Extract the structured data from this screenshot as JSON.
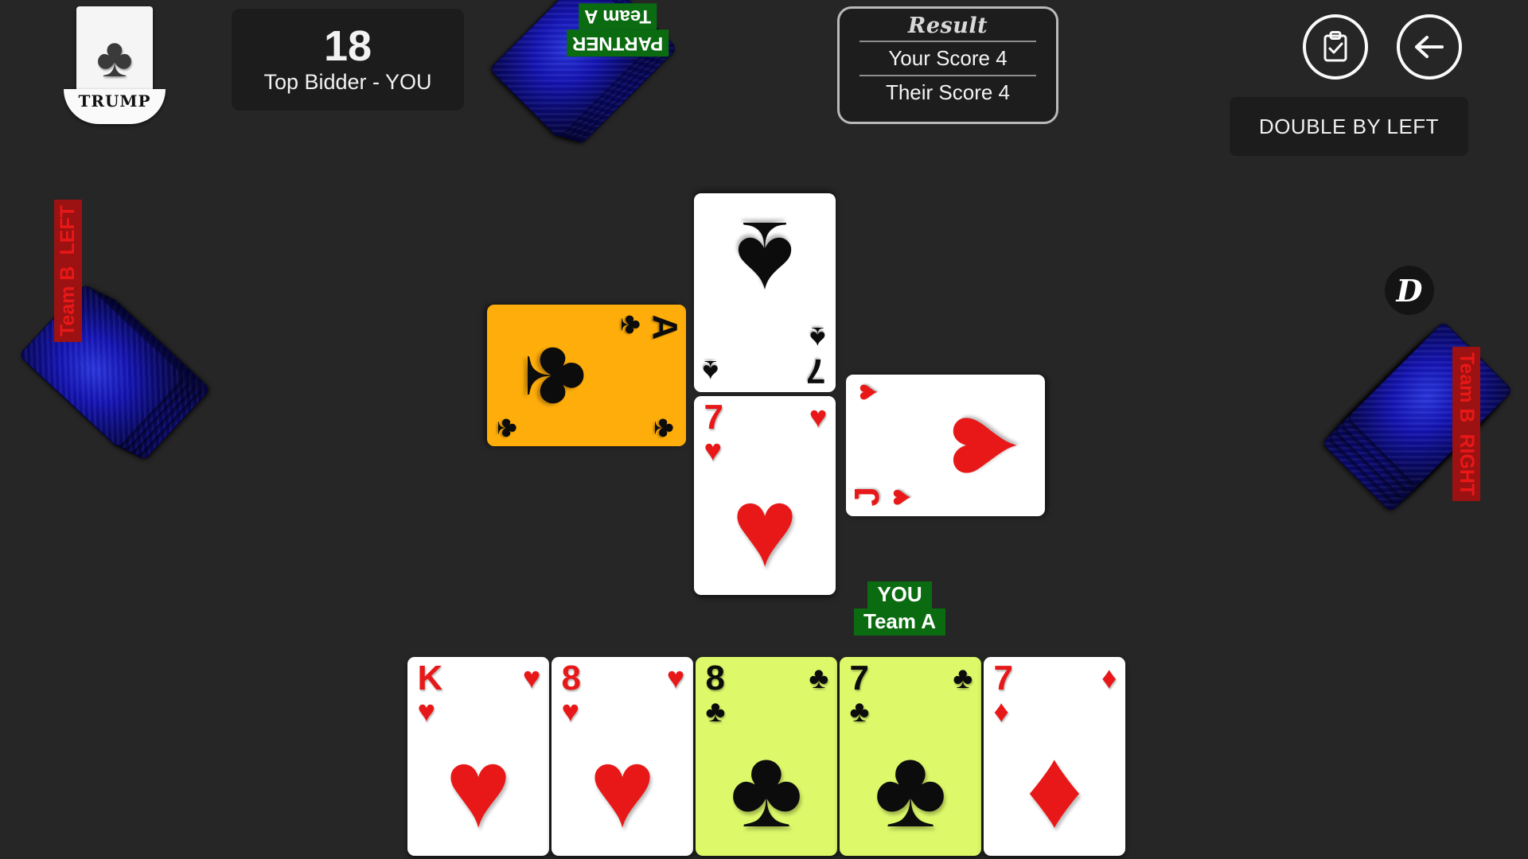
{
  "app": {
    "background_color": "#262626"
  },
  "trump": {
    "label": "TRUMP",
    "suit": "clubs",
    "suit_glyph": "♣",
    "color": "#3a3a3a"
  },
  "bid": {
    "value": "18",
    "label": "Top Bidder - YOU"
  },
  "result": {
    "title": "Result",
    "your_score_label": "Your Score 4",
    "their_score_label": "Their Score 4",
    "your_score": 4,
    "their_score": 4
  },
  "toolbar": {
    "scoreboard_icon": "clipboard-check-icon",
    "back_icon": "back-arrow-icon"
  },
  "notice": {
    "text": "DOUBLE BY LEFT"
  },
  "dealer_badge": {
    "letter": "D"
  },
  "players": {
    "partner": {
      "name": "PARTNER",
      "team": "Team A",
      "team_color": "#0b6b10",
      "cards_remaining": 5
    },
    "left": {
      "name": "LEFT",
      "team": "Team B",
      "team_color": "#9c1111",
      "cards_remaining": 5
    },
    "right": {
      "name": "RIGHT",
      "team": "Team B",
      "team_color": "#9c1111",
      "cards_remaining": 5
    },
    "you": {
      "name": "YOU",
      "team": "Team A",
      "team_color": "#0b6b10"
    }
  },
  "trick": {
    "left_card": {
      "rank": "A",
      "suit": "♣",
      "color": "blk",
      "highlight": "orange",
      "rotation": 90,
      "label": "Ace of Clubs"
    },
    "top_card": {
      "rank": "7",
      "suit": "♠",
      "color": "blk",
      "highlight": "none",
      "rotation": 180,
      "label": "Seven of Spades"
    },
    "right_card": {
      "rank": "J",
      "suit": "♥",
      "color": "red",
      "highlight": "none",
      "rotation": -90,
      "label": "Jack of Hearts"
    },
    "bottom_card": {
      "rank": "7",
      "suit": "♥",
      "color": "red",
      "highlight": "none",
      "rotation": 0,
      "label": "Seven of Hearts"
    }
  },
  "hand": {
    "cards": [
      {
        "rank": "K",
        "suit": "♥",
        "color": "red",
        "highlight": "none",
        "label": "King of Hearts"
      },
      {
        "rank": "8",
        "suit": "♥",
        "color": "red",
        "highlight": "none",
        "label": "Eight of Hearts"
      },
      {
        "rank": "8",
        "suit": "♣",
        "color": "blk",
        "highlight": "green",
        "label": "Eight of Clubs"
      },
      {
        "rank": "7",
        "suit": "♣",
        "color": "blk",
        "highlight": "green",
        "label": "Seven of Clubs"
      },
      {
        "rank": "7",
        "suit": "♦",
        "color": "red",
        "highlight": "none",
        "label": "Seven of Diamonds"
      }
    ]
  }
}
